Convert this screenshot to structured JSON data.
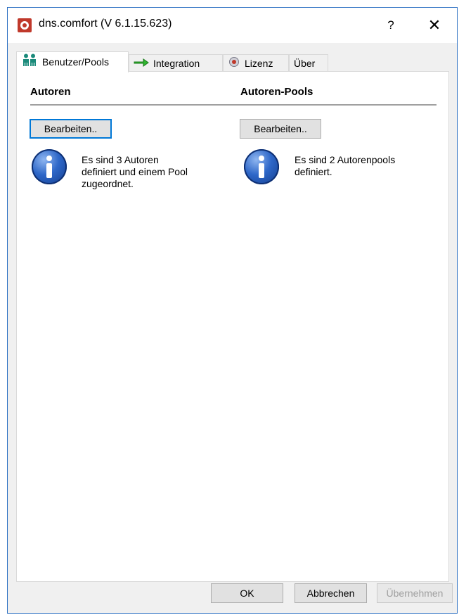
{
  "window": {
    "title": "dns.comfort (V 6.1.15.623)",
    "help_label": "?",
    "close_label": "✕"
  },
  "tabs": [
    {
      "label": "Benutzer/Pools",
      "icon": "users-icon",
      "active": true
    },
    {
      "label": "Integration",
      "icon": "green-arrow-icon",
      "active": false
    },
    {
      "label": "Lizenz",
      "icon": "seal-icon",
      "active": false
    },
    {
      "label": "Über",
      "icon": "",
      "active": false
    }
  ],
  "left": {
    "heading": "Autoren",
    "edit_label": "Bearbeiten..",
    "info_text": "Es sind 3 Autoren\ndefiniert und einem Pool\nzugeordnet."
  },
  "right": {
    "heading": "Autoren-Pools",
    "edit_label": "Bearbeiten..",
    "info_text": "Es sind 2 Autorenpools\ndefiniert."
  },
  "footer": {
    "ok_label": "OK",
    "cancel_label": "Abbrechen",
    "apply_label": "Übernehmen"
  },
  "colors": {
    "accent": "#0078d7",
    "window_border": "#2b6fc2",
    "info_blue": "#2e67c8"
  }
}
